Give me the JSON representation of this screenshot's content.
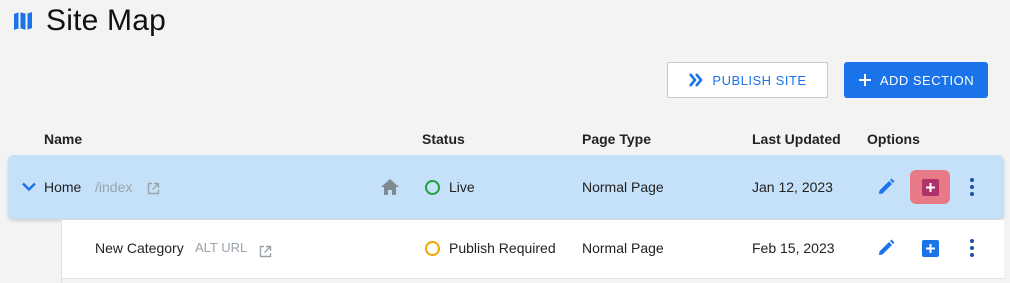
{
  "header": {
    "title": "Site Map",
    "icon": "map-icon"
  },
  "actions": {
    "publish_label": "PUBLISH SITE",
    "add_section_label": "ADD SECTION"
  },
  "columns": {
    "name": "Name",
    "status": "Status",
    "page_type": "Page Type",
    "last_updated": "Last Updated",
    "options": "Options"
  },
  "rows": [
    {
      "name": "Home",
      "path": "/index",
      "status": "Live",
      "status_color": "#1e9e3c",
      "page_type": "Normal Page",
      "last_updated": "Jan 12, 2023",
      "expanded": true,
      "is_home": true
    },
    {
      "name": "New Category",
      "path": "ALT URL",
      "status": "Publish Required",
      "status_color": "#f0a500",
      "page_type": "Normal Page",
      "last_updated": "Feb 15, 2023",
      "expanded": false,
      "is_home": false
    }
  ],
  "colors": {
    "accent": "#1a73e8",
    "row_selected": "#c4e1f9",
    "add_highlight": "#e77a86",
    "add_icon_highlighted": "#b0326b"
  }
}
